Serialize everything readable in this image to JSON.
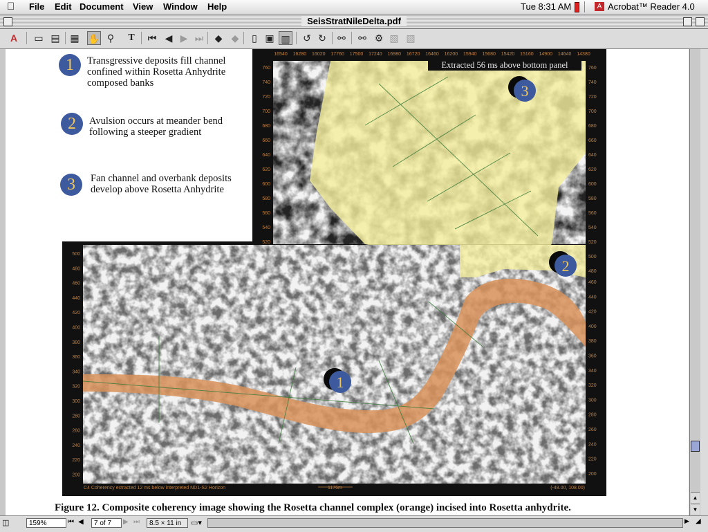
{
  "menubar": {
    "items": [
      "File",
      "Edit",
      "Document",
      "View",
      "Window",
      "Help"
    ],
    "clock": "Tue 8:31 AM",
    "app_name": "Acrobat™ Reader 4.0"
  },
  "window": {
    "title": "SeisStratNileDelta.pdf"
  },
  "toolbar": {
    "buttons": [
      "open-file",
      "print",
      "show-bookmarks",
      "hand-tool",
      "zoom-tool",
      "text-select",
      "first-page",
      "previous-page",
      "next-page",
      "last-page",
      "go-back",
      "go-forward",
      "actual-size",
      "fit-in-window",
      "fit-width",
      "rotate-left",
      "rotate-right",
      "find",
      "search",
      "search-results",
      "previous-highlight",
      "next-highlight"
    ]
  },
  "legend": [
    {
      "num": "1",
      "text": [
        "Transgressive deposits fill channel",
        "confined within Rosetta Anhydrite",
        "composed banks"
      ]
    },
    {
      "num": "2",
      "text": [
        "Avulsion occurs at meander bend",
        "following a steeper gradient"
      ]
    },
    {
      "num": "3",
      "text": [
        "Fan channel and overbank deposits",
        "develop above Rosetta Anhydrite"
      ]
    }
  ],
  "figure": {
    "top_panel_label": "Extracted 56 ms above bottom panel",
    "top_axis_ticks": [
      "16540",
      "16280",
      "16020",
      "17760",
      "17500",
      "17240",
      "16980",
      "16720",
      "16460",
      "16200",
      "15940",
      "15680",
      "15420",
      "15160",
      "14900",
      "14640",
      "14380"
    ],
    "top_left_ticks": [
      "760",
      "740",
      "720",
      "700",
      "680",
      "660",
      "640",
      "620",
      "600",
      "580",
      "560",
      "540",
      "520"
    ],
    "top_right_ticks": [
      "760",
      "740",
      "720",
      "700",
      "680",
      "660",
      "640",
      "620",
      "600",
      "580",
      "560",
      "540",
      "520",
      "500",
      "480"
    ],
    "bottom_left_ticks": [
      "500",
      "480",
      "460",
      "440",
      "420",
      "400",
      "380",
      "360",
      "340",
      "320",
      "300",
      "280",
      "260",
      "240",
      "220",
      "200"
    ],
    "bottom_right_ticks": [
      "460",
      "440",
      "420",
      "400",
      "380",
      "360",
      "340",
      "320",
      "300",
      "280",
      "260",
      "240",
      "220",
      "200"
    ],
    "bottom_caption_left": "C4 Coherency extracted 12 ms below interpreted ND1-S2 Horizon",
    "scale_label": "1176m",
    "bottom_caption_right": "(-48.00, 108.00)",
    "markers": [
      "1",
      "2",
      "3"
    ],
    "colors": {
      "channel": "#d9925a",
      "fan": "#f4ee9c",
      "marker": "#3d5a9f",
      "marker_text": "#f2c75a"
    }
  },
  "caption": "Figure 12. Composite coherency image showing the Rosetta channel complex (orange) incised into Rosetta anhydrite.",
  "statusbar": {
    "zoom": "159%",
    "page": "7 of 7",
    "page_size": "8.5 × 11 in"
  }
}
